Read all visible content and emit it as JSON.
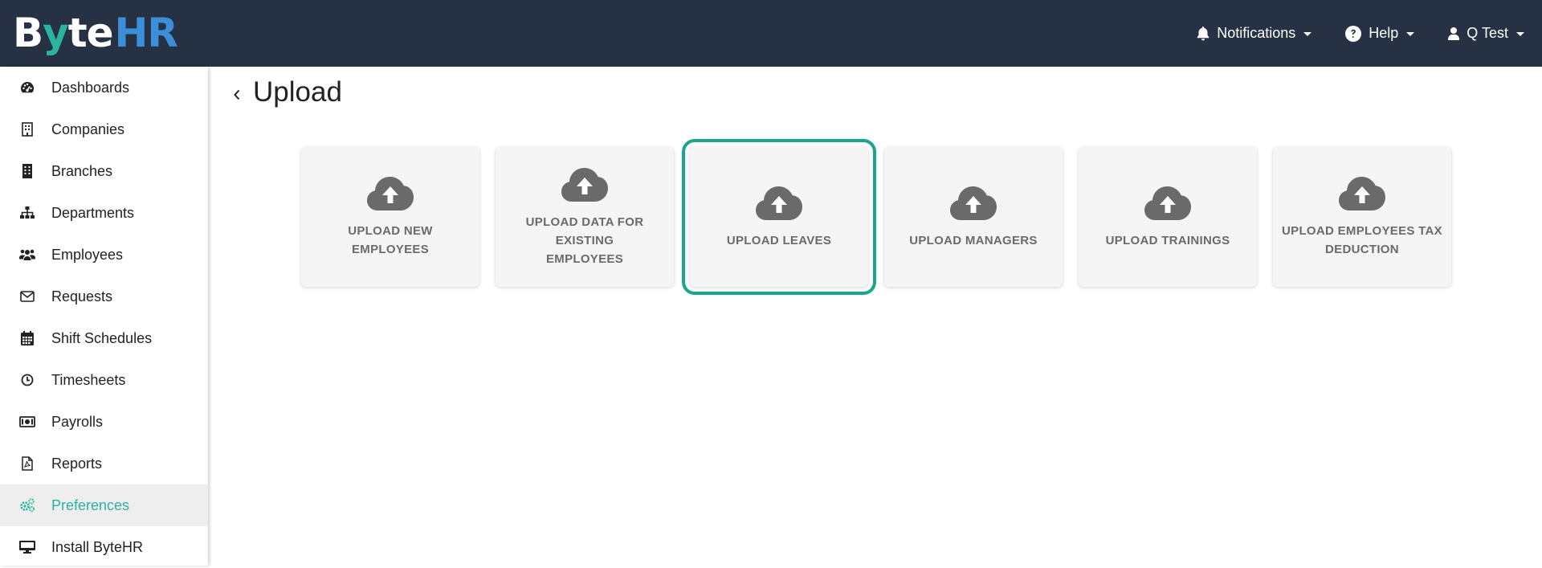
{
  "brand": {
    "logo_text": "ByteHR",
    "logo_b": "B",
    "logo_y": "y",
    "logo_te": "te",
    "logo_hr": "HR",
    "colors": {
      "topbar": "#263244",
      "accent": "#2ab3a0",
      "hr_blue": "#3b8fd8",
      "selected_outline": "#1aa68c"
    }
  },
  "topnav": {
    "notifications": {
      "label": "Notifications",
      "icon": "bell-icon"
    },
    "help": {
      "label": "Help",
      "icon": "question-circle-icon"
    },
    "user": {
      "label": "Q Test",
      "icon": "user-icon"
    }
  },
  "sidebar": {
    "items": [
      {
        "label": "Dashboards",
        "icon": "dashboard-gauge-icon",
        "active": false
      },
      {
        "label": "Companies",
        "icon": "building-icon",
        "active": false
      },
      {
        "label": "Branches",
        "icon": "building-solid-icon",
        "active": false
      },
      {
        "label": "Departments",
        "icon": "sitemap-icon",
        "active": false
      },
      {
        "label": "Employees",
        "icon": "users-icon",
        "active": false
      },
      {
        "label": "Requests",
        "icon": "envelope-icon",
        "active": false
      },
      {
        "label": "Shift Schedules",
        "icon": "calendar-icon",
        "active": false
      },
      {
        "label": "Timesheets",
        "icon": "clock-icon",
        "active": false
      },
      {
        "label": "Payrolls",
        "icon": "money-bill-icon",
        "active": false
      },
      {
        "label": "Reports",
        "icon": "file-pdf-icon",
        "active": false
      },
      {
        "label": "Preferences",
        "icon": "cogs-icon",
        "active": true
      },
      {
        "label": "Install ByteHR",
        "icon": "desktop-icon",
        "active": false
      }
    ]
  },
  "main": {
    "title": "Upload",
    "cards": [
      {
        "line1": "UPLOAD NEW EMPLOYEES",
        "line2": "",
        "icon": "cloud-upload-icon",
        "selected": false
      },
      {
        "line1": "UPLOAD DATA FOR EXISTING",
        "line2": "EMPLOYEES",
        "icon": "cloud-upload-icon",
        "selected": false
      },
      {
        "line1": "UPLOAD LEAVES",
        "line2": "",
        "icon": "cloud-upload-icon",
        "selected": true
      },
      {
        "line1": "UPLOAD MANAGERS",
        "line2": "",
        "icon": "cloud-upload-icon",
        "selected": false
      },
      {
        "line1": "UPLOAD TRAININGS",
        "line2": "",
        "icon": "cloud-upload-icon",
        "selected": false
      },
      {
        "line1": "UPLOAD EMPLOYEES TAX",
        "line2": "DEDUCTION",
        "icon": "cloud-upload-icon",
        "selected": false
      }
    ]
  }
}
